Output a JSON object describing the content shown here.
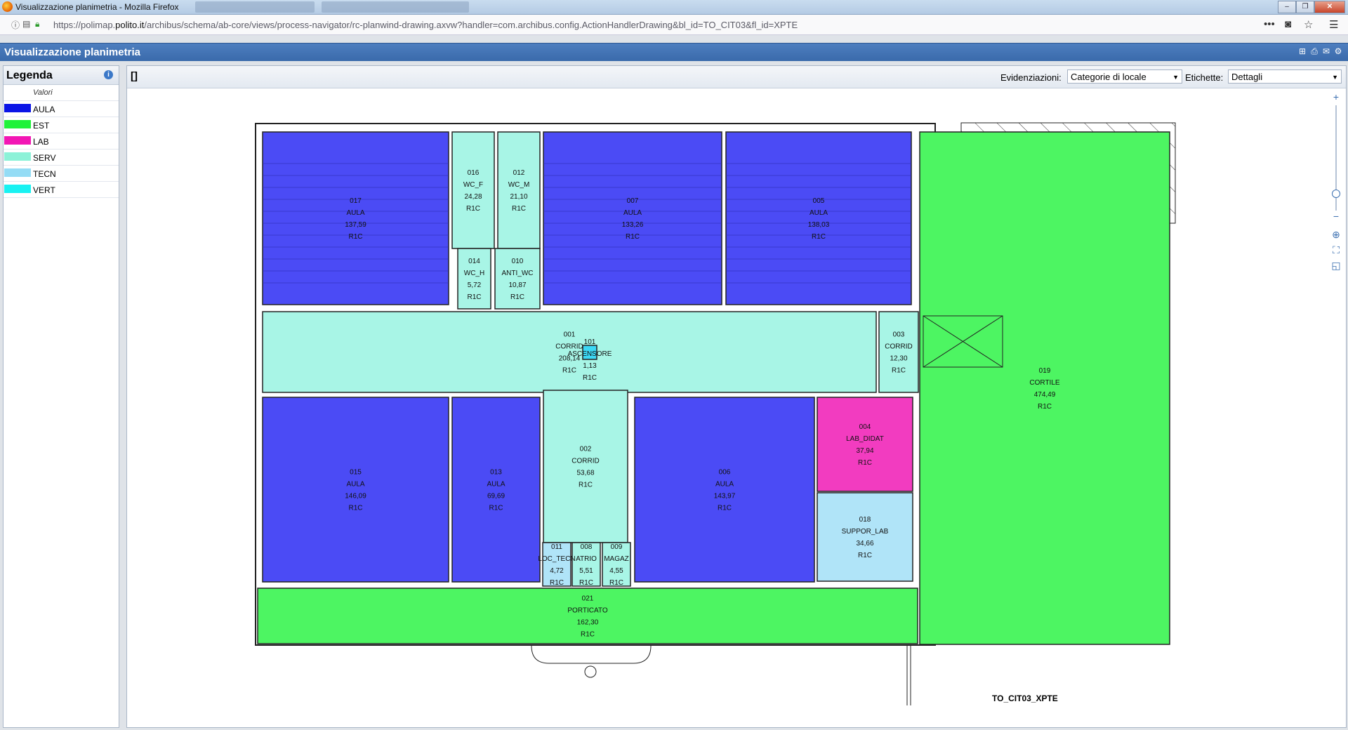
{
  "browser": {
    "window_title": "Visualizzazione planimetria - Mozilla Firefox",
    "url_host_prefix": "https://polimap.",
    "url_host_domain": "polito.it",
    "url_path": "/archibus/schema/ab-core/views/process-navigator/rc-planwind-drawing.axvw?handler=com.archibus.config.ActionHandlerDrawing&bl_id=TO_CIT03&fl_id=XPTE",
    "window_buttons": [
      "–",
      "❐",
      "✕"
    ]
  },
  "app": {
    "title": "Visualizzazione planimetria",
    "header_icons": [
      "add-icon",
      "print-icon",
      "mail-icon",
      "tools-icon"
    ]
  },
  "legend": {
    "title": "Legenda",
    "column_header": "Valori",
    "items": [
      {
        "label": "AULA",
        "color": "#0a14e6"
      },
      {
        "label": "EST",
        "color": "#1ff23a"
      },
      {
        "label": "LAB",
        "color": "#f216b4"
      },
      {
        "label": "SERV",
        "color": "#8df2d8"
      },
      {
        "label": "TECN",
        "color": "#94dcf5"
      },
      {
        "label": "VERT",
        "color": "#19f2f2"
      }
    ]
  },
  "toolbar": {
    "selection_indicator": "[]",
    "highlight_label": "Evidenziazioni:",
    "highlight_value": "Categorie di locale",
    "labels_label": "Etichette:",
    "labels_value": "Dettagli"
  },
  "drawing": {
    "floor_code": "TO_CIT03_XPTE",
    "rooms": [
      {
        "id": "017",
        "type": "AULA",
        "area": "137,59",
        "code": "R1C",
        "category": "AULA"
      },
      {
        "id": "016",
        "type": "WC_F",
        "area": "24,28",
        "code": "R1C",
        "category": "SERV"
      },
      {
        "id": "012",
        "type": "WC_M",
        "area": "21,10",
        "code": "R1C",
        "category": "SERV"
      },
      {
        "id": "014",
        "type": "WC_H",
        "area": "5,72",
        "code": "R1C",
        "category": "SERV"
      },
      {
        "id": "010",
        "type": "ANTI_WC",
        "area": "10,87",
        "code": "R1C",
        "category": "SERV"
      },
      {
        "id": "007",
        "type": "AULA",
        "area": "133,26",
        "code": "R1C",
        "category": "AULA"
      },
      {
        "id": "005",
        "type": "AULA",
        "area": "138,03",
        "code": "R1C",
        "category": "AULA"
      },
      {
        "id": "001",
        "type": "CORRID",
        "area": "208,14",
        "code": "R1C",
        "category": "SERV"
      },
      {
        "id": "101",
        "type": "ASCENSORE",
        "area": "1,13",
        "code": "R1C",
        "category": "VERT"
      },
      {
        "id": "003",
        "type": "CORRID",
        "area": "12,30",
        "code": "R1C",
        "category": "SERV"
      },
      {
        "id": "019",
        "type": "CORTILE",
        "area": "474,49",
        "code": "R1C",
        "category": "EST"
      },
      {
        "id": "015",
        "type": "AULA",
        "area": "146,09",
        "code": "R1C",
        "category": "AULA"
      },
      {
        "id": "013",
        "type": "AULA",
        "area": "69,69",
        "code": "R1C",
        "category": "AULA"
      },
      {
        "id": "002",
        "type": "CORRID",
        "area": "53,68",
        "code": "R1C",
        "category": "SERV"
      },
      {
        "id": "006",
        "type": "AULA",
        "area": "143,97",
        "code": "R1C",
        "category": "AULA"
      },
      {
        "id": "004",
        "type": "LAB_DIDAT",
        "area": "37,94",
        "code": "R1C",
        "category": "LAB"
      },
      {
        "id": "018",
        "type": "SUPPOR_LAB",
        "area": "34,66",
        "code": "R1C",
        "category": "TECN"
      },
      {
        "id": "011",
        "type": "LOC_TECN",
        "area": "4,72",
        "code": "R1C",
        "category": "TECN"
      },
      {
        "id": "008",
        "type": "ATRIO",
        "area": "5,51",
        "code": "R1C",
        "category": "SERV"
      },
      {
        "id": "009",
        "type": "MAGAZ",
        "area": "4,55",
        "code": "R1C",
        "category": "SERV"
      },
      {
        "id": "021",
        "type": "PORTICATO",
        "area": "162,30",
        "code": "R1C",
        "category": "EST"
      }
    ]
  }
}
